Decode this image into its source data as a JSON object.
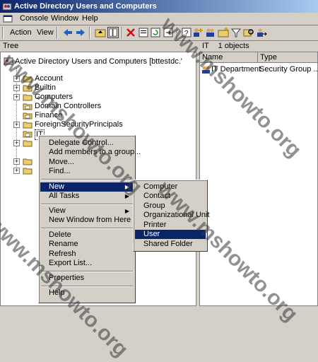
{
  "window": {
    "title": "Active Directory Users and Computers"
  },
  "menubar": [
    {
      "label": "Console"
    },
    {
      "label": "Window"
    },
    {
      "label": "Help"
    }
  ],
  "toolbar": {
    "action": "Action",
    "view": "View"
  },
  "tree": {
    "header": "Tree",
    "root": "Active Directory Users and Computers [bttestdc.'",
    "items": [
      {
        "label": "Account"
      },
      {
        "label": "Builtin"
      },
      {
        "label": "Computers"
      },
      {
        "label": "Domain Controllers"
      },
      {
        "label": "Finance"
      },
      {
        "label": "ForeignSecurityPrincipals"
      },
      {
        "label": "IT"
      }
    ]
  },
  "right": {
    "header_name": "IT",
    "header_count": "1 objects",
    "columns": [
      "Name",
      "Type"
    ],
    "rows": [
      {
        "name": "IT Department",
        "type": "Security Group ..."
      }
    ]
  },
  "context_menu": {
    "items": [
      "Delegate Control...",
      "Add members to a group...",
      "Move...",
      "Find...",
      "New",
      "All Tasks",
      "View",
      "New Window from Here",
      "Delete",
      "Rename",
      "Refresh",
      "Export List...",
      "Properties",
      "Help"
    ]
  },
  "submenu_new": {
    "items": [
      "Computer",
      "Contact",
      "Group",
      "Organizational Unit",
      "Printer",
      "User",
      "Shared Folder"
    ]
  },
  "watermark": {
    "text": "www.mshowto.org"
  },
  "colors": {
    "titlebar": "#0a246a",
    "highlight": "#0a246a",
    "folder": "#e8d070"
  }
}
